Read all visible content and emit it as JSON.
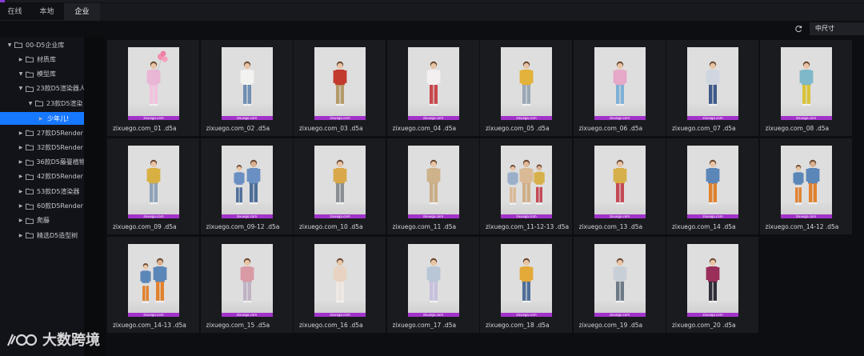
{
  "tabs": [
    {
      "label": "在线",
      "active": false
    },
    {
      "label": "本地",
      "active": false
    },
    {
      "label": "企业",
      "active": true
    }
  ],
  "toolbar": {
    "size_select": "中尺寸",
    "refresh_icon": "refresh-icon"
  },
  "sidebar": {
    "items": [
      {
        "label": "00-D5企业库",
        "depth": 0,
        "expanded": true,
        "selected": false
      },
      {
        "label": "材质库",
        "depth": 1,
        "expanded": false,
        "selected": false
      },
      {
        "label": "模型库",
        "depth": 1,
        "expanded": true,
        "selected": false
      },
      {
        "label": "23款D5渲染器人",
        "depth": 2,
        "expanded": true,
        "selected": false
      },
      {
        "label": "23款D5渲染",
        "depth": 3,
        "expanded": true,
        "selected": false
      },
      {
        "label": "少年儿!",
        "depth": 4,
        "expanded": false,
        "selected": true
      },
      {
        "label": "27款D5Render",
        "depth": 2,
        "expanded": false,
        "selected": false
      },
      {
        "label": "32款D5Render",
        "depth": 2,
        "expanded": false,
        "selected": false
      },
      {
        "label": "36款D5藤曼植物",
        "depth": 2,
        "expanded": false,
        "selected": false
      },
      {
        "label": "42款D5Render",
        "depth": 2,
        "expanded": false,
        "selected": false
      },
      {
        "label": "53款D5渲染器",
        "depth": 2,
        "expanded": false,
        "selected": false
      },
      {
        "label": "60款D5Render",
        "depth": 2,
        "expanded": false,
        "selected": false
      },
      {
        "label": "爬藤",
        "depth": 2,
        "expanded": false,
        "selected": false
      },
      {
        "label": "精选D5造型树",
        "depth": 2,
        "expanded": false,
        "selected": false
      }
    ]
  },
  "assets": {
    "watermark": "zixuego.com",
    "items": [
      {
        "name": "zixuego.com_01 .d5a",
        "people": 1,
        "top": "#e9b6d6",
        "bottom": "#f0c2dc",
        "balloons": true
      },
      {
        "name": "zixuego.com_02 .d5a",
        "people": 1,
        "top": "#f2f2f0",
        "bottom": "#6f8fb2"
      },
      {
        "name": "zixuego.com_03 .d5a",
        "people": 1,
        "top": "#c23a2e",
        "bottom": "#b49a6a"
      },
      {
        "name": "zixuego.com_04 .d5a",
        "people": 1,
        "top": "#f3eff1",
        "bottom": "#c8484c"
      },
      {
        "name": "zixuego.com_05 .d5a",
        "people": 1,
        "top": "#e3b23a",
        "bottom": "#9aa8b5"
      },
      {
        "name": "zixuego.com_06 .d5a",
        "people": 1,
        "top": "#e6a9c8",
        "bottom": "#7fb0d6"
      },
      {
        "name": "zixuego.com_07 .d5a",
        "people": 1,
        "top": "#cfd6df",
        "bottom": "#3e5a8a"
      },
      {
        "name": "zixuego.com_08 .d5a",
        "people": 1,
        "top": "#7fb8c9",
        "bottom": "#d9c23a"
      },
      {
        "name": "zixuego.com_09 .d5a",
        "people": 1,
        "top": "#d8b042",
        "bottom": "#8fa3b8"
      },
      {
        "name": "zixuego.com_09-12 .d5a",
        "people": 2,
        "top": "#6a8fc2",
        "bottom": "#4d6e98"
      },
      {
        "name": "zixuego.com_10 .d5a",
        "people": 1,
        "top": "#d9a84a",
        "bottom": "#8a8f96"
      },
      {
        "name": "zixuego.com_11 .d5a",
        "people": 1,
        "top": "#cdb28c",
        "bottom": "#c9ad86"
      },
      {
        "name": "zixuego.com_11-12-13 .d5a",
        "people": 3,
        "top": "#9ab0c9",
        "bottom": "#d9b996"
      },
      {
        "name": "zixuego.com_13 .d5a",
        "people": 1,
        "top": "#d6b04a",
        "bottom": "#c44a55"
      },
      {
        "name": "zixuego.com_14 .d5a",
        "people": 1,
        "top": "#5b86b8",
        "bottom": "#e0812e"
      },
      {
        "name": "zixuego.com_14-12 .d5a",
        "people": 2,
        "top": "#5b86b8",
        "bottom": "#e0812e"
      },
      {
        "name": "zixuego.com_14-13 .d5a",
        "people": 2,
        "top": "#5b86b8",
        "bottom": "#e0812e"
      },
      {
        "name": "zixuego.com_15 .d5a",
        "people": 1,
        "top": "#d99aa6",
        "bottom": "#bfb3c4"
      },
      {
        "name": "zixuego.com_16 .d5a",
        "people": 1,
        "top": "#e8d3c2",
        "bottom": "#efe8e2"
      },
      {
        "name": "zixuego.com_17 .d5a",
        "people": 1,
        "top": "#b8c6d6",
        "bottom": "#c7c0dc"
      },
      {
        "name": "zixuego.com_18 .d5a",
        "people": 1,
        "top": "#e3aa3a",
        "bottom": "#4e6f98"
      },
      {
        "name": "zixuego.com_19 .d5a",
        "people": 1,
        "top": "#c9cfd6",
        "bottom": "#6d7a86"
      },
      {
        "name": "zixuego.com_20 .d5a",
        "people": 1,
        "top": "#9a2f5a",
        "bottom": "#2e2e3a"
      }
    ]
  },
  "logo": {
    "text": "大数跨境"
  }
}
